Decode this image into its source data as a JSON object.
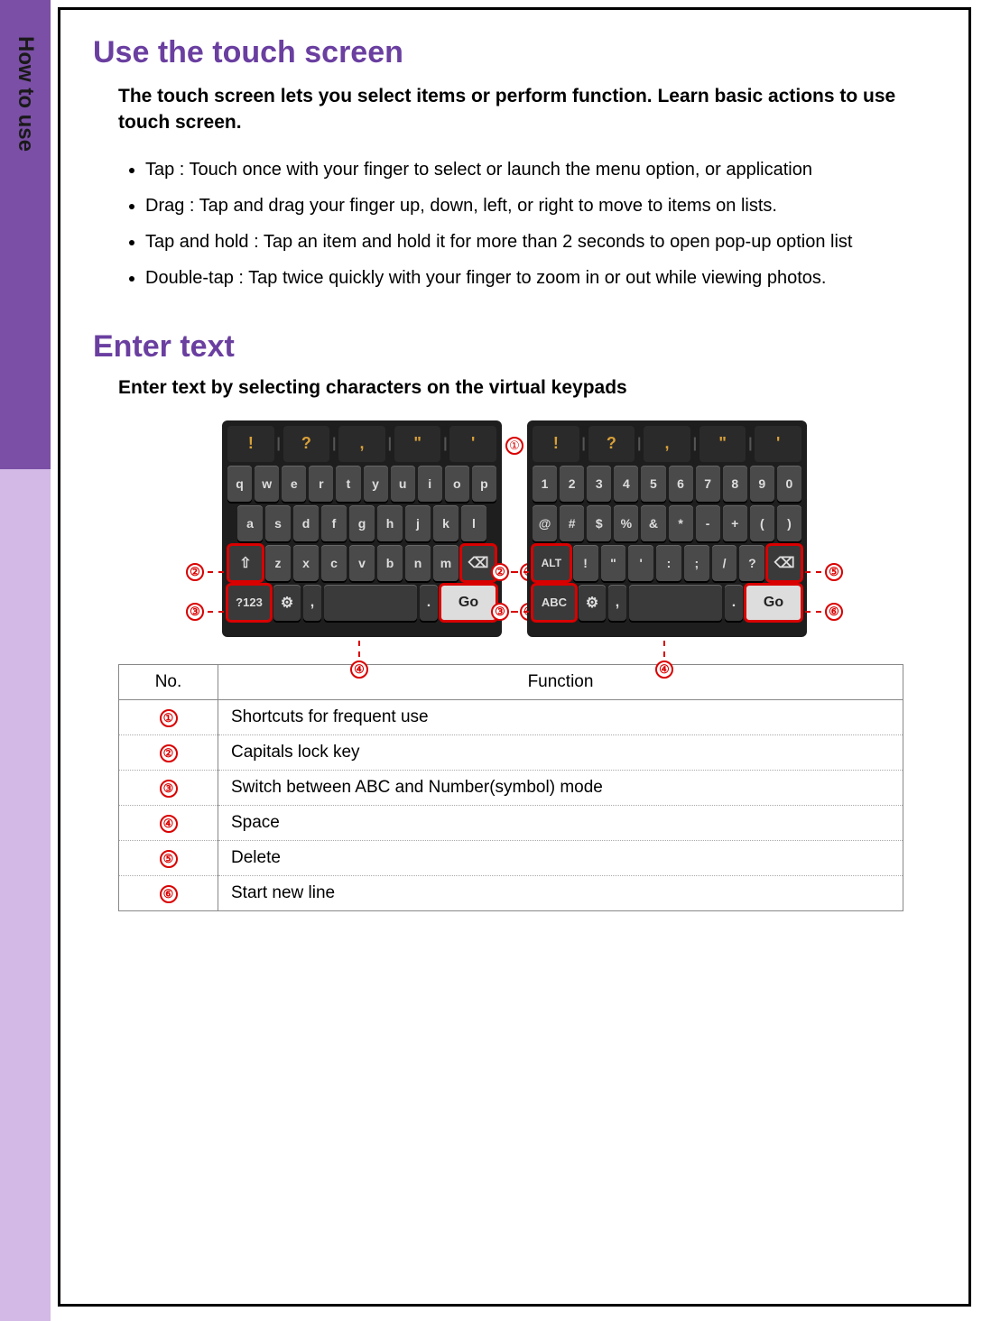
{
  "sidebar": {
    "tab": "How to use"
  },
  "sections": {
    "touch": {
      "heading": "Use the touch screen",
      "intro": "The touch screen lets you select items or perform function. Learn basic actions to use touch screen.",
      "items": [
        "Tap : Touch once with your finger to select or launch the menu option, or application",
        "Drag : Tap and drag your finger up, down, left, or right to move to items on lists.",
        "Tap and hold : Tap an item and hold it for more than 2 seconds to open pop-up option list",
        "Double-tap : Tap twice quickly with your finger to zoom in or out while viewing photos."
      ]
    },
    "enter": {
      "heading": "Enter text",
      "sub": "Enter text by selecting characters on the virtual keypads"
    }
  },
  "keyboard_left": {
    "toprow": [
      "!",
      "?",
      ",",
      "\"",
      "'"
    ],
    "row1": [
      "q",
      "w",
      "e",
      "r",
      "t",
      "y",
      "u",
      "i",
      "o",
      "p"
    ],
    "row2": [
      "a",
      "s",
      "d",
      "f",
      "g",
      "h",
      "j",
      "k",
      "l"
    ],
    "row3": {
      "shift": "⇧",
      "keys": [
        "z",
        "x",
        "c",
        "v",
        "b",
        "n",
        "m"
      ],
      "bksp": "⌫"
    },
    "row4": {
      "mode": "?123",
      "globe": "⚙",
      "comma": ",",
      "period": ".",
      "go": "Go"
    }
  },
  "keyboard_right": {
    "toprow": [
      "!",
      "?",
      ",",
      "\"",
      "'"
    ],
    "row1": [
      "1",
      "2",
      "3",
      "4",
      "5",
      "6",
      "7",
      "8",
      "9",
      "0"
    ],
    "row2": [
      "@",
      "#",
      "$",
      "%",
      "&",
      "*",
      "-",
      "+",
      "(",
      ")"
    ],
    "row3": {
      "alt": "ALT",
      "keys": [
        "!",
        "\"",
        "'",
        ":",
        ";",
        "/",
        "?"
      ],
      "bksp": "⌫"
    },
    "row4": {
      "mode": "ABC",
      "globe": "⚙",
      "comma": ",",
      "period": ".",
      "go": "Go"
    }
  },
  "callouts": {
    "1": "①",
    "2": "②",
    "3": "③",
    "4": "④",
    "5": "⑤",
    "6": "⑥"
  },
  "table": {
    "head": {
      "no": "No.",
      "func": "Function"
    },
    "rows": [
      {
        "no": "①",
        "func": "Shortcuts for frequent use"
      },
      {
        "no": "②",
        "func": "Capitals lock key"
      },
      {
        "no": "③",
        "func": "Switch between ABC and Number(symbol) mode"
      },
      {
        "no": "④",
        "func": "Space"
      },
      {
        "no": "⑤",
        "func": "Delete"
      },
      {
        "no": "⑥",
        "func": "Start new line"
      }
    ]
  }
}
